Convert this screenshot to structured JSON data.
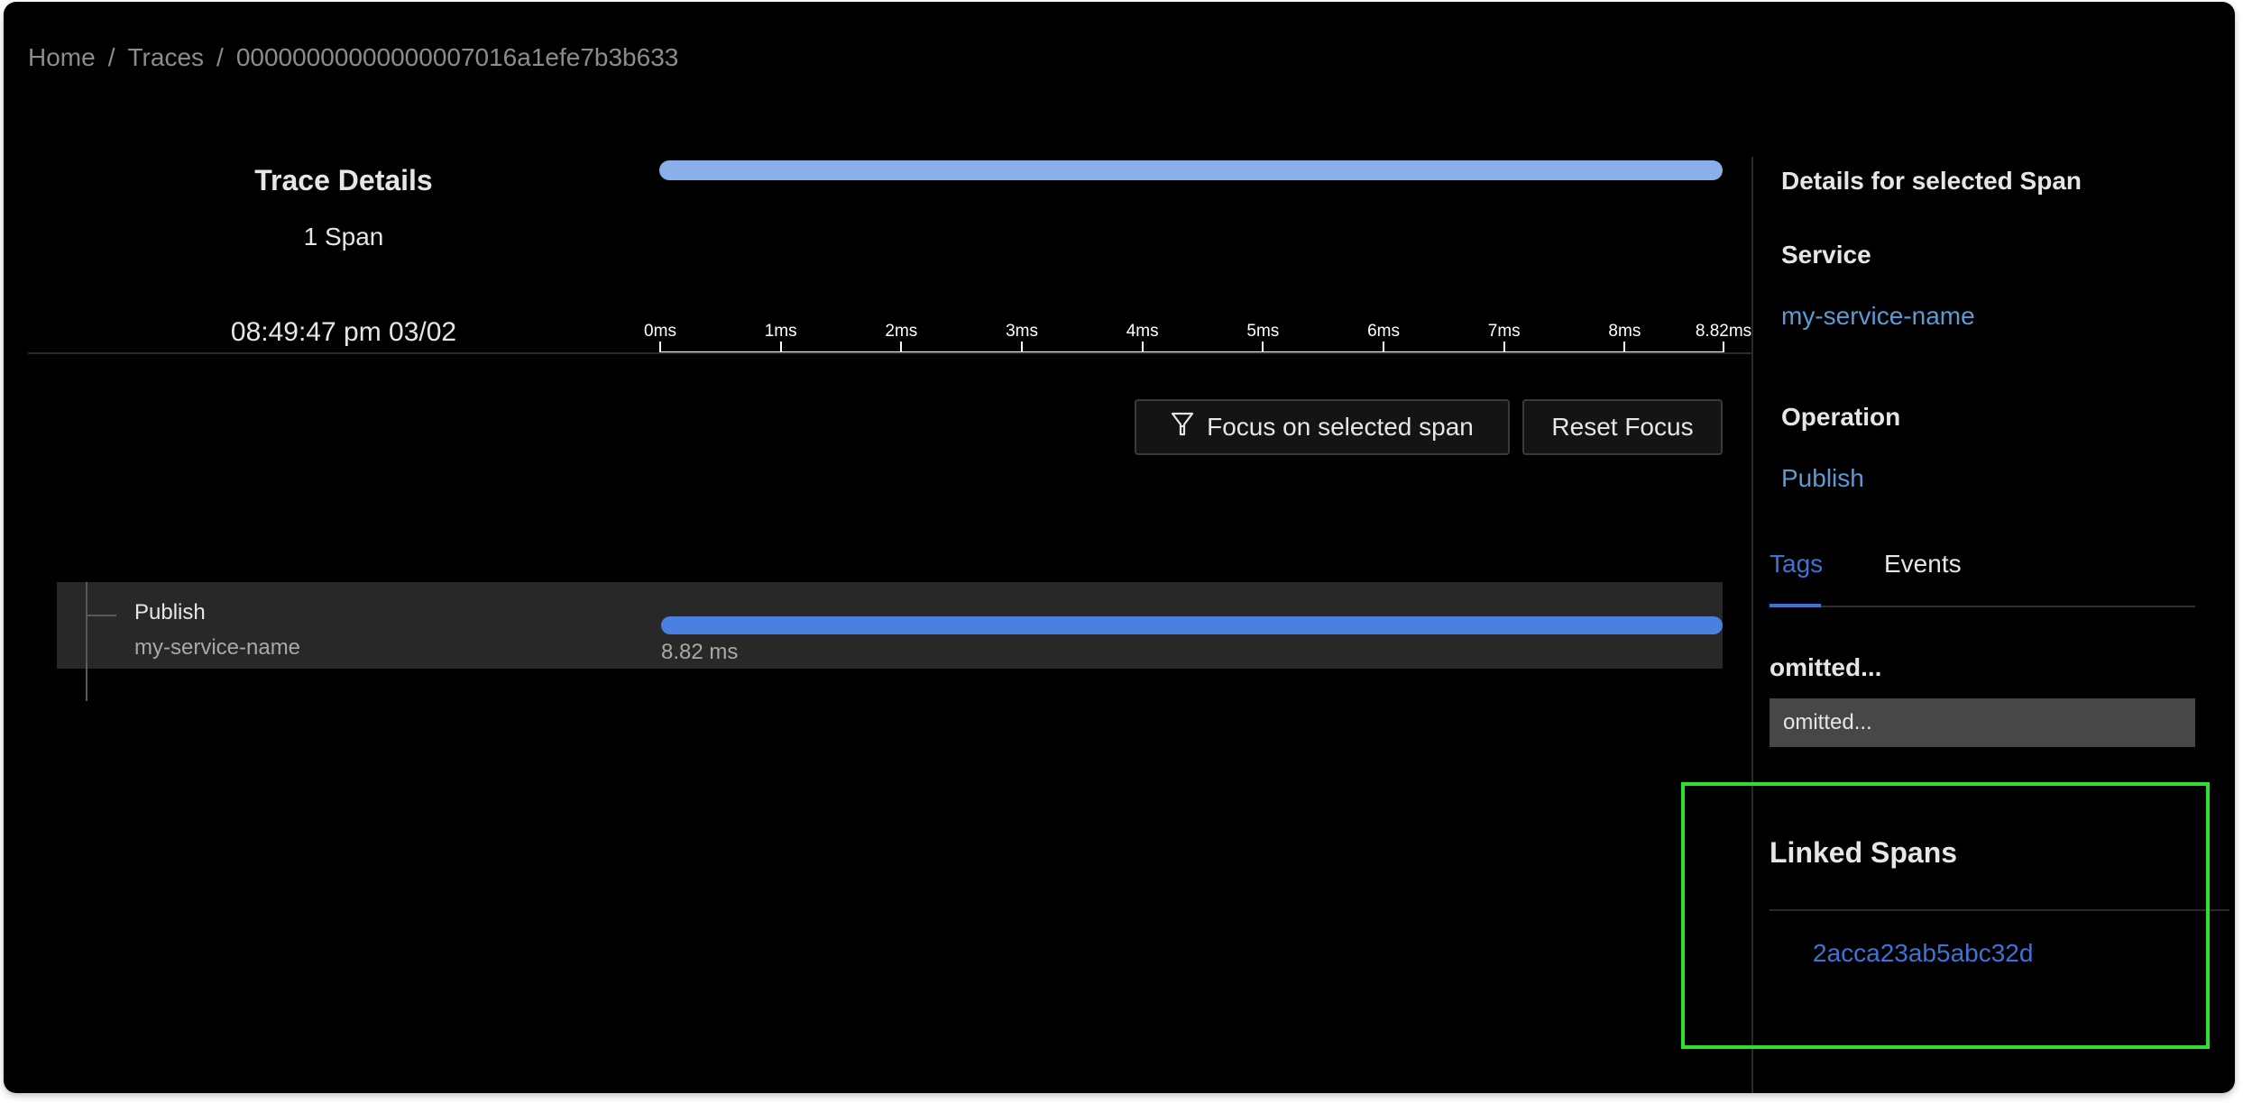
{
  "breadcrumb": {
    "items": [
      "Home",
      "Traces",
      "00000000000000007016a1efe7b3b633"
    ],
    "separator": "/"
  },
  "trace_summary": {
    "title": "Trace Details",
    "span_count": "1 Span",
    "start_time": "08:49:47 pm 03/02"
  },
  "timeline": {
    "unit": "ms",
    "total_duration_ms": 8.82,
    "ticks": [
      "0ms",
      "1ms",
      "2ms",
      "3ms",
      "4ms",
      "5ms",
      "6ms",
      "7ms",
      "8ms",
      "8.82ms"
    ],
    "tick_values_ms": [
      0,
      1,
      2,
      3,
      4,
      5,
      6,
      7,
      8,
      8.82
    ],
    "overview_bar": {
      "start_ms": 0,
      "end_ms": 8.82,
      "color": "#8ab0ec"
    }
  },
  "toolbar": {
    "focus_label": "Focus on selected span",
    "focus_icon": "filter-icon",
    "reset_label": "Reset Focus"
  },
  "spans": [
    {
      "operation": "Publish",
      "service": "my-service-name",
      "start_ms": 0,
      "duration_ms": 8.82,
      "duration_label": "8.82 ms",
      "color": "#4a80e0",
      "selected": true
    }
  ],
  "details_panel": {
    "title": "Details for selected Span",
    "service_label": "Service",
    "service_value": "my-service-name",
    "operation_label": "Operation",
    "operation_value": "Publish",
    "tabs": [
      {
        "label": "Tags",
        "active": true
      },
      {
        "label": "Events",
        "active": false
      }
    ],
    "tags": [
      {
        "key": "omitted...",
        "value": "omitted..."
      }
    ],
    "linked_spans": {
      "title": "Linked Spans",
      "items": [
        "2acca23ab5abc32d"
      ]
    }
  },
  "colors": {
    "accent": "#3f72d6",
    "link": "#5b9bd5",
    "highlight_box": "#2fe02f",
    "background": "#000000"
  }
}
